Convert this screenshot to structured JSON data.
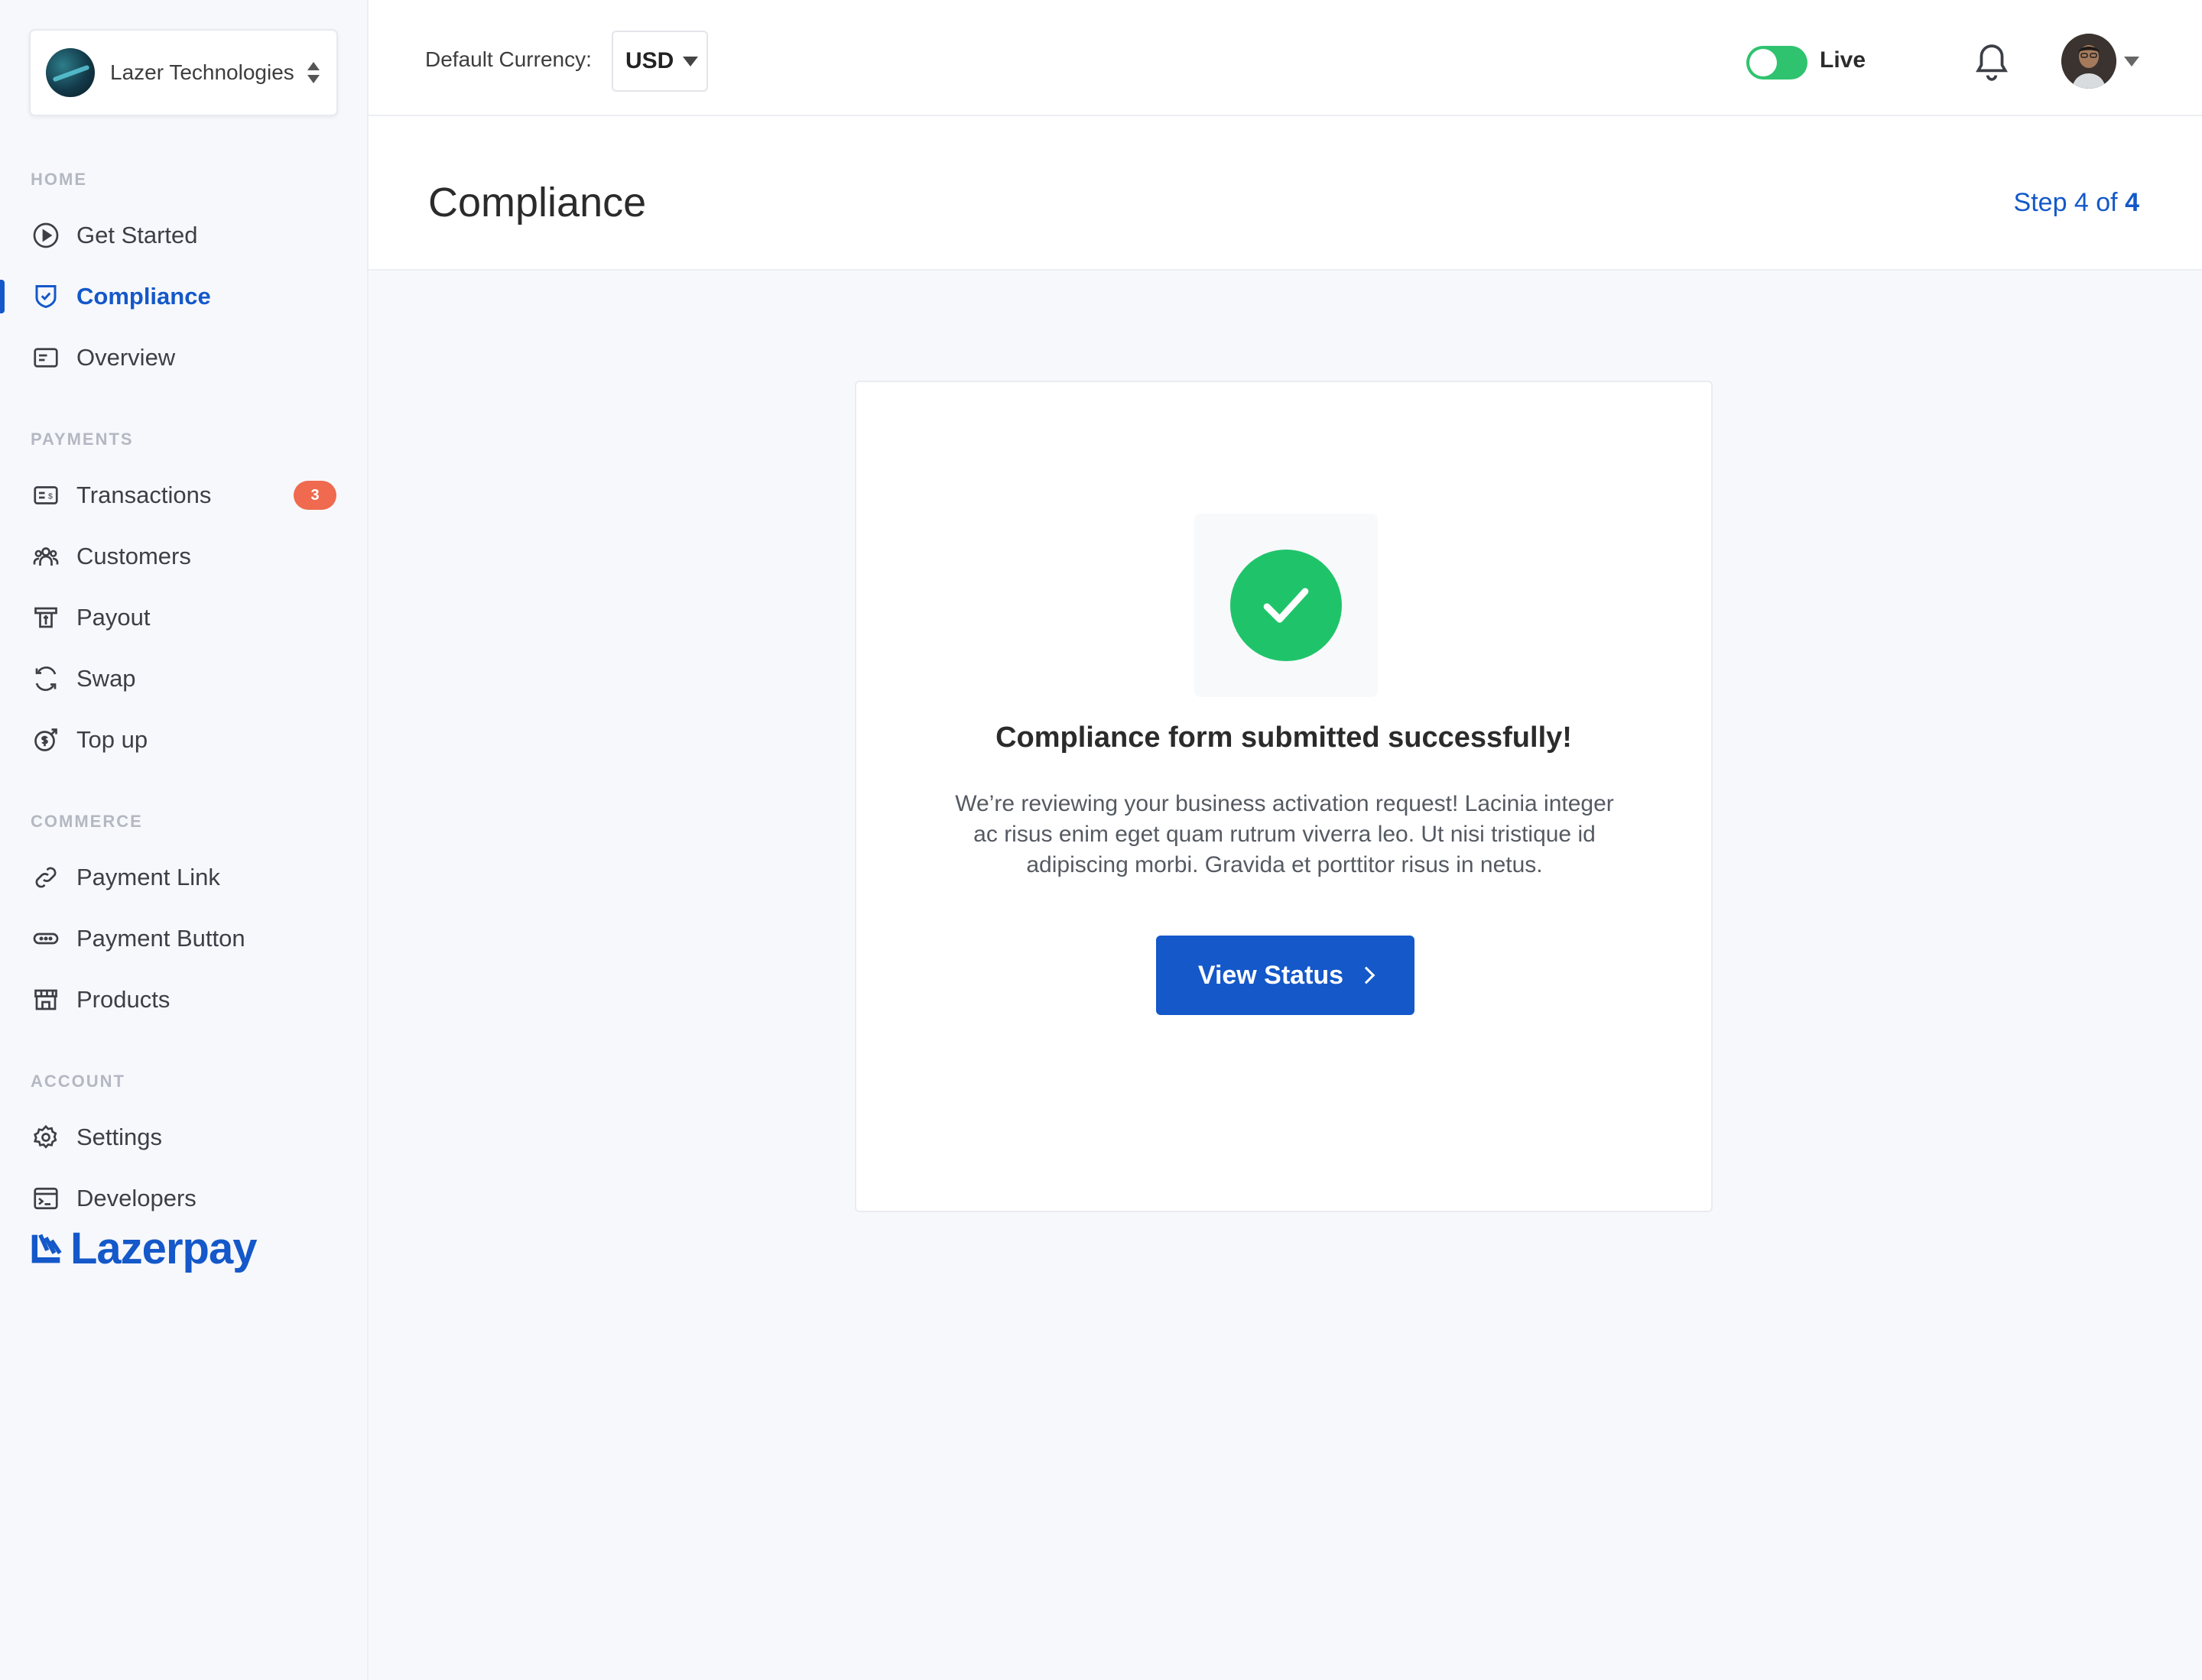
{
  "org": {
    "name": "Lazer Technologies"
  },
  "sidebar": {
    "sections": {
      "home": "HOME",
      "payments": "PAYMENTS",
      "commerce": "COMMERCE",
      "account": "ACCOUNT"
    },
    "items": {
      "get_started": "Get Started",
      "compliance": "Compliance",
      "overview": "Overview",
      "transactions": "Transactions",
      "transactions_badge": "3",
      "customers": "Customers",
      "payout": "Payout",
      "swap": "Swap",
      "top_up": "Top up",
      "payment_link": "Payment Link",
      "payment_button": "Payment Button",
      "products": "Products",
      "settings": "Settings",
      "developers": "Developers"
    },
    "active": "compliance",
    "brand": "Lazerpay"
  },
  "topbar": {
    "currency_label": "Default Currency:",
    "currency_value": "USD",
    "mode_label": "Live",
    "mode_on": true
  },
  "page": {
    "title": "Compliance",
    "step_prefix": "Step 4 of ",
    "step_total": "4"
  },
  "card": {
    "title": "Compliance form submitted successfully!",
    "description": "We’re reviewing your business activation request! Lacinia integer ac risus enim eget quam rutrum viverra leo. Ut nisi tristique id adipiscing morbi. Gravida et porttitor risus in netus.",
    "button_label": "View Status"
  },
  "colors": {
    "accent": "#1458c9",
    "success": "#1fc46a",
    "badge": "#ef6a4e",
    "toggle": "#2fc36f"
  },
  "icons": {
    "get_started": "play-circle-icon",
    "compliance": "shield-check-icon",
    "overview": "card-icon",
    "transactions": "wallet-icon",
    "customers": "users-icon",
    "payout": "atm-icon",
    "swap": "refresh-icon",
    "top_up": "coin-up-icon",
    "payment_link": "link-icon",
    "payment_button": "button-icon",
    "products": "store-icon",
    "settings": "gear-icon",
    "developers": "terminal-icon"
  }
}
